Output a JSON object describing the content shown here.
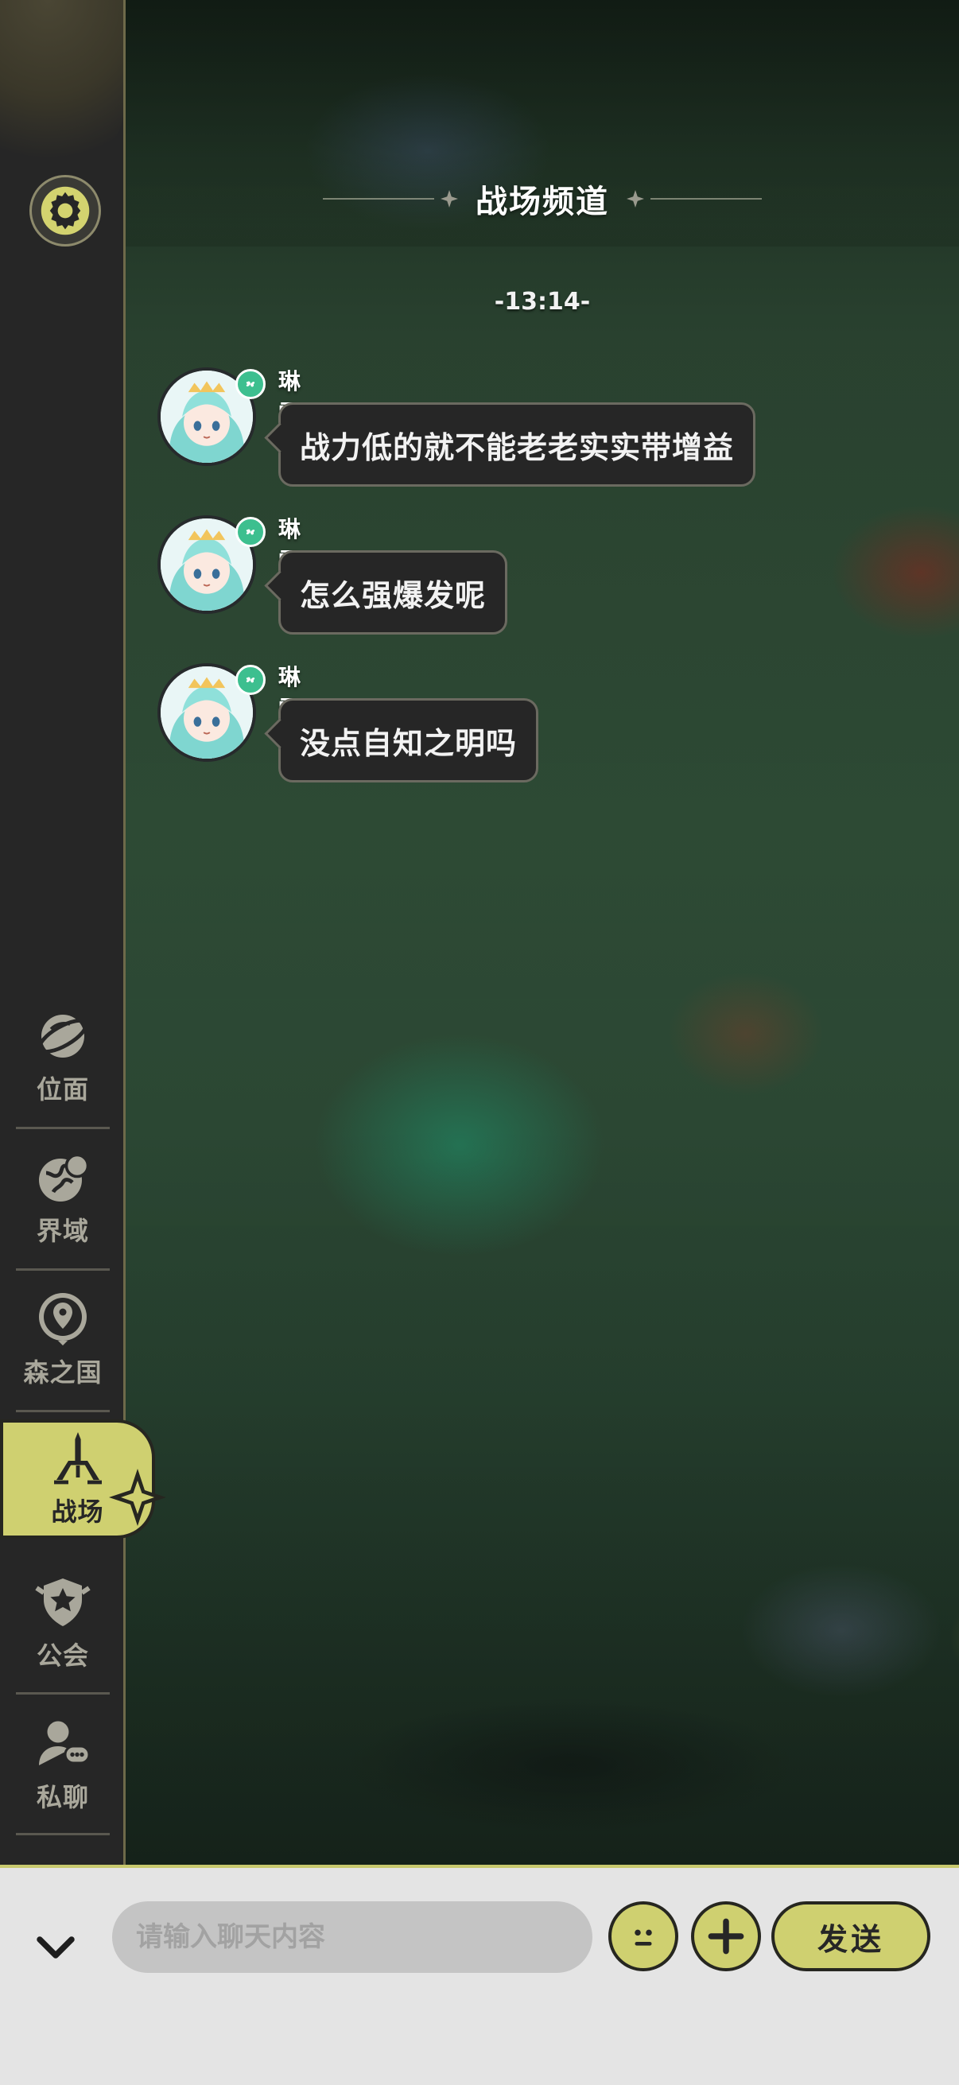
{
  "header": {
    "title": "战场频道"
  },
  "chat": {
    "time_separator": "-13:14-",
    "messages": [
      {
        "sender": "琳雪",
        "text": "战力低的就不能老老实实带增益"
      },
      {
        "sender": "琳雪",
        "text": "怎么强爆发呢"
      },
      {
        "sender": "琳雪",
        "text": "没点自知之明吗"
      }
    ]
  },
  "sidebar": {
    "settings_icon": "gear-icon",
    "items": [
      {
        "label": "位面",
        "icon": "planet-icon",
        "active": false
      },
      {
        "label": "界域",
        "icon": "globe-icon",
        "active": false
      },
      {
        "label": "森之国",
        "icon": "location-pin-icon",
        "active": false
      },
      {
        "label": "战场",
        "icon": "crossed-swords-icon",
        "active": true
      },
      {
        "label": "公会",
        "icon": "guild-shield-icon",
        "active": false
      },
      {
        "label": "私聊",
        "icon": "private-chat-icon",
        "active": false
      }
    ]
  },
  "input_bar": {
    "placeholder": "请输入聊天内容",
    "value": "",
    "send_label": "发送"
  },
  "colors": {
    "accent": "#cfd070",
    "sidebar_bg": "#262626",
    "bubble_bg": "#262626",
    "input_bar_bg": "#e4e4e4"
  }
}
